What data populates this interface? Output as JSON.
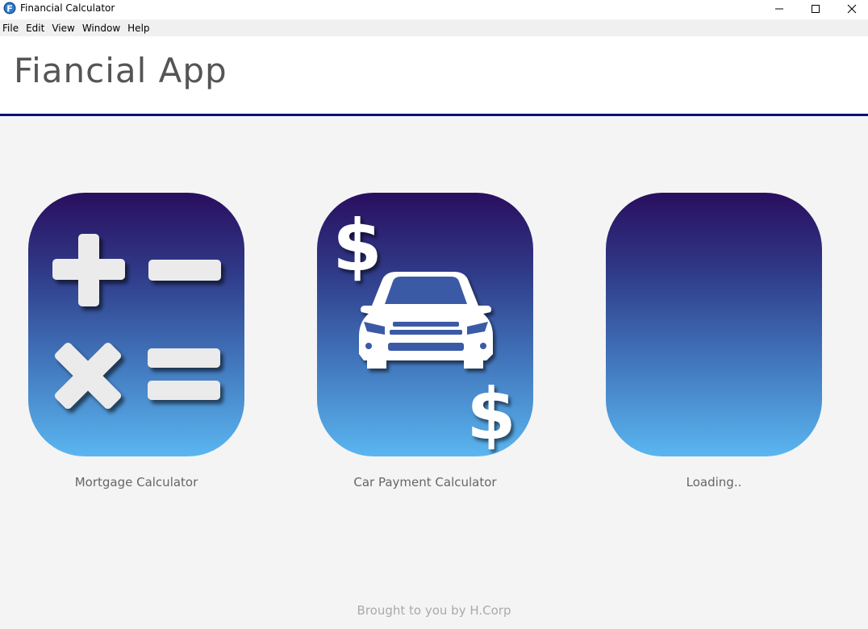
{
  "window": {
    "title": "Financial Calculator",
    "app_icon_letter": "F"
  },
  "menubar": {
    "items": [
      "File",
      "Edit",
      "View",
      "Window",
      "Help"
    ]
  },
  "header": {
    "title": "Fiancial App"
  },
  "cards": [
    {
      "label": "Mortgage Calculator",
      "icon": "calculator-operators-icon"
    },
    {
      "label": "Car Payment Calculator",
      "icon": "car-dollar-icon"
    },
    {
      "label": "Loading..",
      "icon": "blank-tile"
    }
  ],
  "footer": {
    "text": "Brought to you by H.Corp"
  },
  "colors": {
    "header_border": "#0d0f7a",
    "tile_gradient_top": "#2a0e5f",
    "tile_gradient_bottom": "#5ab6f0",
    "icon_fill": "#ebebeb"
  }
}
